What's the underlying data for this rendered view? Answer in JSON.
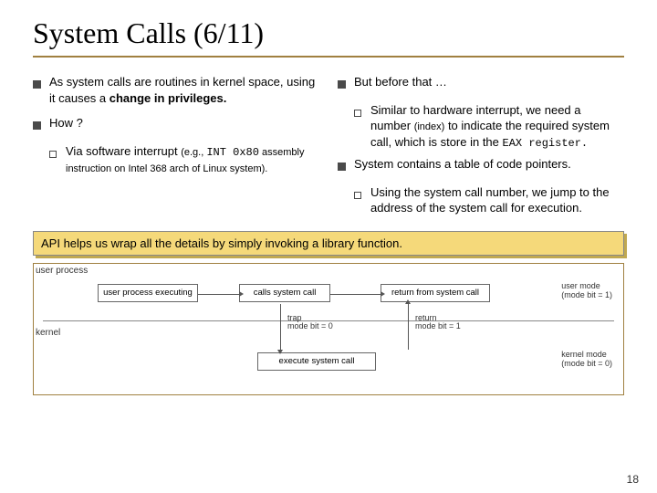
{
  "title": "System Calls (6/11)",
  "left": {
    "b1": "As system calls are routines in kernel space, using it causes a ",
    "b1_bold": "change in privileges.",
    "b2": "How ?",
    "b2_sub_pre": "Via software interrupt ",
    "b2_sub_small1": "(e.g., ",
    "b2_sub_mono": "INT 0x80",
    "b2_sub_small2": " assembly instruction on Intel 368 arch of Linux system)."
  },
  "right": {
    "b1": "But before that …",
    "b1_sub_pre": "Similar to hardware interrupt, we need a number ",
    "b1_sub_small": "(index)",
    "b1_sub_post": " to indicate the required system call, which is store in the ",
    "b1_sub_mono": "EAX register.",
    "b2": "System contains a table of code pointers.",
    "b2_sub": "Using the system call number, we jump to the address of the system call for execution."
  },
  "callout": "API helps us wrap all the details by simply invoking a library function.",
  "diagram": {
    "row1_label": "user process",
    "row2_label": "kernel",
    "box_user": "user process executing",
    "box_call": "calls system call",
    "box_return": "return from system call",
    "box_exec": "execute system call",
    "arr_trap_a": "trap",
    "arr_trap_b": "mode bit = 0",
    "arr_ret_a": "return",
    "arr_ret_b": "mode bit = 1",
    "side1_a": "user mode",
    "side1_b": "(mode bit = 1)",
    "side2_a": "kernel mode",
    "side2_b": "(mode bit = 0)"
  },
  "page": "18"
}
